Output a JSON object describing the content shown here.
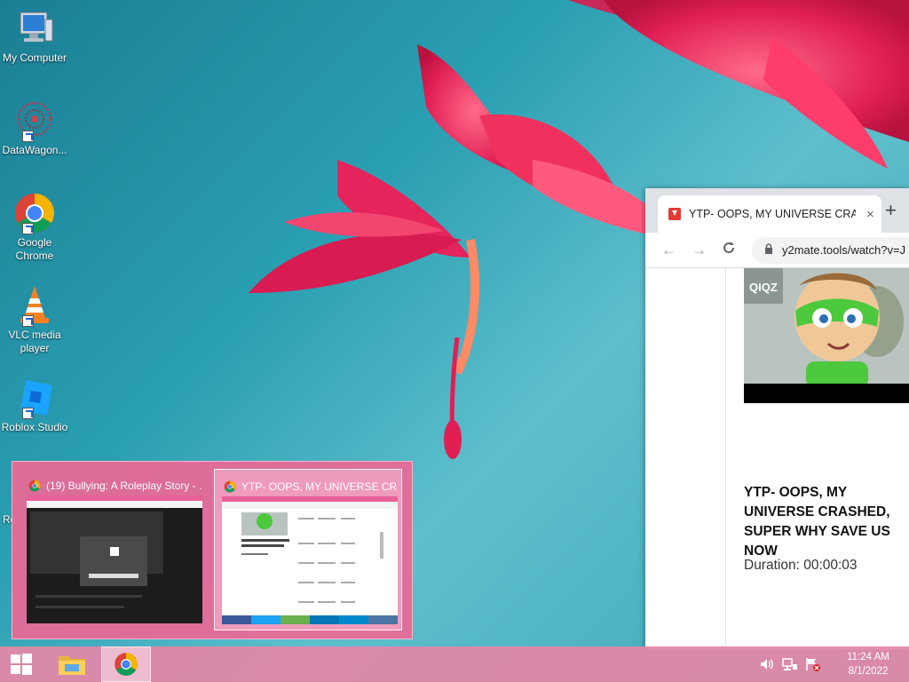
{
  "desktop": {
    "icons": [
      {
        "label": "My Computer",
        "icon": "computer-icon"
      },
      {
        "label": "DataWagon...",
        "icon": "datawagon-icon"
      },
      {
        "label": "Google Chrome",
        "icon": "chrome-icon"
      },
      {
        "label": "VLC media player",
        "icon": "vlc-icon"
      },
      {
        "label": "Roblox Studio",
        "icon": "roblox-studio-icon"
      }
    ],
    "partial_icon_label": "Ro"
  },
  "browser": {
    "tab_title": "YTP- OOPS, MY UNIVERSE CRASHED, SUPER WHY SAVE US NOW",
    "tab_close": "×",
    "new_tab": "+",
    "back": "←",
    "forward": "→",
    "reload": "C",
    "url": "y2mate.tools/watch?v=J",
    "video_title": "YTP- OOPS, MY UNIVERSE CRASHED, SUPER WHY SAVE US NOW",
    "duration": "Duration: 00:00:03",
    "thumbnail_watermark": "QIQZ"
  },
  "preview": {
    "cards": [
      {
        "title": "(19) Bullying: A Roleplay Story - ..."
      },
      {
        "title": "YTP- OOPS, MY UNIVERSE CRA..."
      }
    ]
  },
  "taskbar": {
    "apps": [
      {
        "name": "start",
        "icon": "windows-logo-icon"
      },
      {
        "name": "file-explorer",
        "icon": "folder-icon"
      },
      {
        "name": "chrome",
        "icon": "chrome-icon"
      }
    ],
    "tray": [
      {
        "icon": "speaker-icon"
      },
      {
        "icon": "network-icon"
      },
      {
        "icon": "action-center-flag-icon"
      }
    ],
    "time": "11:24 AM",
    "date": "8/1/2022"
  },
  "colors": {
    "taskbar": "#e187a8",
    "preview_bg": "#ec6896",
    "wallpaper_bg": "#2a9fb2",
    "flower": "#e8245a"
  }
}
